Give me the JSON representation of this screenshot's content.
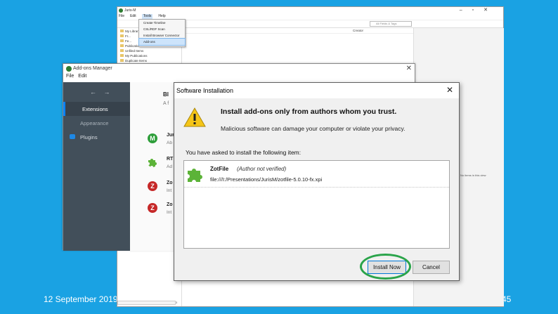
{
  "slide": {
    "date": "12 September 2019",
    "page_number": "45"
  },
  "jurism_window": {
    "title": "Juris-M",
    "menu": [
      "File",
      "Edit",
      "Tools",
      "Help"
    ],
    "search_placeholder": "All Fields & Tags",
    "tree": [
      "My Library",
      "Fr...",
      "Fe...",
      "Publications",
      "Unfiled Items",
      "My Publications",
      "Duplicate Items"
    ],
    "column_creator": "Creator",
    "right_note": "No items in this view",
    "bottom_tab": "3"
  },
  "tools_menu": {
    "items": [
      "Create Timeline",
      "CSL/RDF Scan",
      "Install Browser Connector",
      "Add-ons"
    ],
    "selected_index": 3
  },
  "addons_manager": {
    "title": "Add-ons Manager",
    "menu": [
      "File",
      "Edit"
    ],
    "nav_arrows": "← →",
    "categories": [
      "Extensions",
      "Appearance",
      "Plugins"
    ],
    "selected_category": "Extensions",
    "heading": "Bl",
    "subheading": "A f",
    "addons": [
      {
        "name": "Jur",
        "desc": "Ab",
        "icon": "m-logo-icon",
        "color": "#2e9e3a"
      },
      {
        "name": "RT",
        "desc": "Ad",
        "icon": "puzzle-icon",
        "color": "#5cb338"
      },
      {
        "name": "Zo",
        "desc": "Int",
        "icon": "z-logo-icon",
        "color": "#c62828"
      },
      {
        "name": "Zo",
        "desc": "Int",
        "icon": "z-logo-icon",
        "color": "#c62828"
      }
    ]
  },
  "dialog": {
    "title": "Software Installation",
    "warning_title": "Install add-ons only from authors whom you trust.",
    "warning_sub": "Malicious software can damage your computer or violate your privacy.",
    "asked_label": "You have asked to install the following item:",
    "item": {
      "name": "ZotFile",
      "note": "(Author not verified)",
      "path": "file:///I:/Presentations/JurisM/zotfile-5.0.10-fx.xpi"
    },
    "install_label": "Install Now",
    "cancel_label": "Cancel",
    "highlight_color": "#2aa44a"
  }
}
